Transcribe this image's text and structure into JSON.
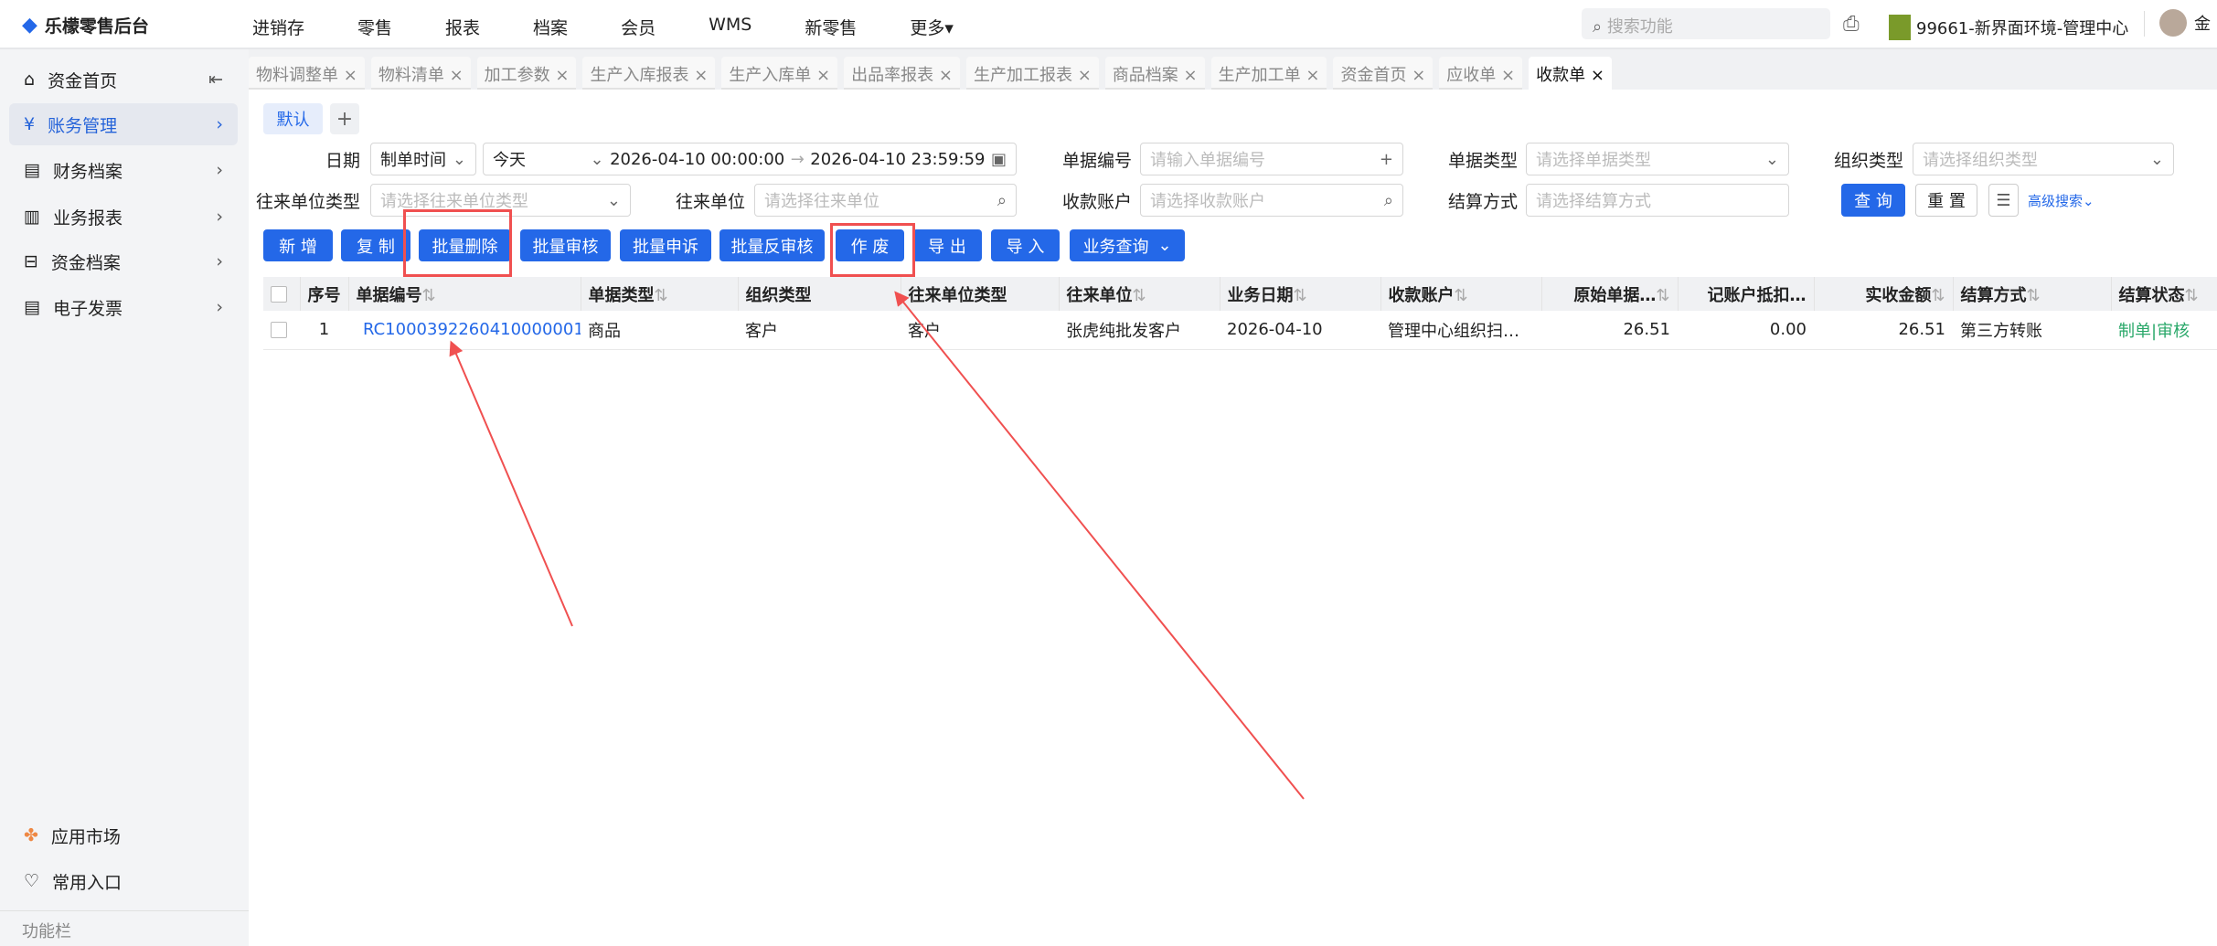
{
  "app": {
    "title": "乐檬零售后台",
    "nav": [
      "进销存",
      "零售",
      "报表",
      "档案",
      "会员",
      "WMS",
      "新零售",
      "更多"
    ],
    "search_placeholder": "搜索功能",
    "store": "99661-新界面环境-管理中心",
    "user": "金"
  },
  "sidebar": {
    "items": [
      {
        "label": "资金首页"
      },
      {
        "label": "账务管理"
      },
      {
        "label": "财务档案"
      },
      {
        "label": "业务报表"
      },
      {
        "label": "资金档案"
      },
      {
        "label": "电子发票"
      }
    ],
    "bottom": [
      {
        "label": "应用市场"
      },
      {
        "label": "常用入口"
      }
    ],
    "footer": "功能栏"
  },
  "tabs": [
    "物料调整单",
    "物料清单",
    "加工参数",
    "生产入库报表",
    "生产入库单",
    "出品率报表",
    "生产加工报表",
    "商品档案",
    "生产加工单",
    "资金首页",
    "应收单",
    "收款单"
  ],
  "scheme": {
    "default": "默认",
    "add": "+"
  },
  "filters": {
    "date_label": "日期",
    "date_type": "制单时间",
    "date_range": "今天",
    "start": "2026-04-10 00:00:00",
    "end": "2026-04-10 23:59:59",
    "doc_no_label": "单据编号",
    "doc_no_ph": "请输入单据编号",
    "doc_type_label": "单据类型",
    "doc_type_ph": "请选择单据类型",
    "org_type_label": "组织类型",
    "org_type_ph": "请选择组织类型",
    "partner_type_label": "往来单位类型",
    "partner_type_ph": "请选择往来单位类型",
    "partner_label": "往来单位",
    "partner_ph": "请选择往来单位",
    "account_label": "收款账户",
    "account_ph": "请选择收款账户",
    "settle_label": "结算方式",
    "settle_ph": "请选择结算方式",
    "query": "查 询",
    "reset": "重 置",
    "advanced": "高级搜索"
  },
  "toolbar": [
    "新 增",
    "复 制",
    "批量删除",
    "批量审核",
    "批量申诉",
    "批量反审核",
    "作 废",
    "导 出",
    "导 入",
    "业务查询"
  ],
  "table": {
    "headers": [
      "序号",
      "单据编号",
      "单据类型",
      "组织类型",
      "往来单位类型",
      "往来单位",
      "业务日期",
      "收款账户",
      "原始单据…",
      "记账户抵扣…",
      "实收金额",
      "结算方式",
      "结算状态"
    ],
    "rows": [
      [
        "1",
        "RC1000392260410000001",
        "商品",
        "客户",
        "客户",
        "张虎纯批发客户",
        "2026-04-10",
        "管理中心组织扫…",
        "26.51",
        "0.00",
        "26.51",
        "第三方转账",
        "制单|审核"
      ]
    ]
  },
  "colors": {
    "accent": "#2468e8",
    "annotation": "#f05050",
    "status": "#2aa86a"
  }
}
